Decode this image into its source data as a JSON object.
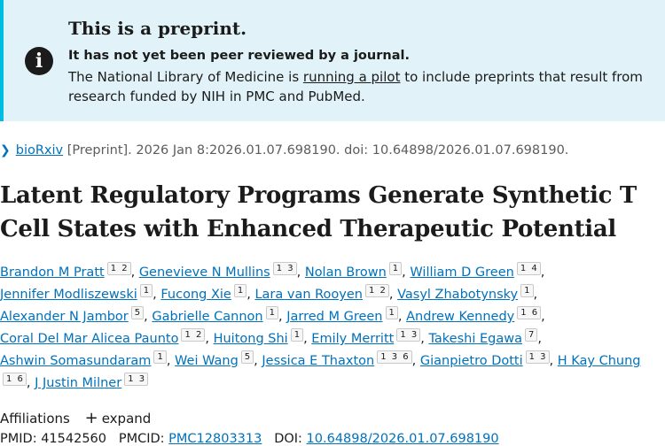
{
  "banner": {
    "title": "This is a preprint.",
    "strong": "It has not yet been peer reviewed by a journal.",
    "text_before": "The National Library of Medicine is ",
    "link": "running a pilot",
    "text_after": " to include preprints that result from research funded by NIH in PMC and PubMed."
  },
  "citation": {
    "journal": "bioRxiv",
    "rest": "[Preprint]. 2026 Jan 8:2026.01.07.698190. doi: 10.64898/2026.01.07.698190."
  },
  "title": "Latent Regulatory Programs Generate Synthetic T Cell States with Enhanced Therapeutic Potential",
  "authors": [
    {
      "name": "Brandon M Pratt",
      "aff": "1 2"
    },
    {
      "name": "Genevieve N Mullins",
      "aff": "1 3"
    },
    {
      "name": "Nolan Brown",
      "aff": "1"
    },
    {
      "name": "William D Green",
      "aff": "1 4"
    },
    {
      "name": "Jennifer Modliszewski",
      "aff": "1"
    },
    {
      "name": "Fucong Xie",
      "aff": "1"
    },
    {
      "name": "Lara van Rooyen",
      "aff": "1 2"
    },
    {
      "name": "Vasyl Zhabotynsky",
      "aff": "1"
    },
    {
      "name": "Alexander N Jambor",
      "aff": "5"
    },
    {
      "name": "Gabrielle Cannon",
      "aff": "1"
    },
    {
      "name": "Jarred M Green",
      "aff": "1"
    },
    {
      "name": "Andrew Kennedy",
      "aff": "1 6"
    },
    {
      "name": "Coral Del Mar Alicea Paunto",
      "aff": "1 2"
    },
    {
      "name": "Huitong Shi",
      "aff": "1"
    },
    {
      "name": "Emily Merritt",
      "aff": "1 3"
    },
    {
      "name": "Takeshi Egawa",
      "aff": "7"
    },
    {
      "name": "Ashwin Somasundaram",
      "aff": "1"
    },
    {
      "name": "Wei Wang",
      "aff": "5"
    },
    {
      "name": "Jessica E Thaxton",
      "aff": "1 3 6"
    },
    {
      "name": "Gianpietro Dotti",
      "aff": "1 3"
    },
    {
      "name": "H Kay Chung",
      "aff": "1 6"
    },
    {
      "name": "J Justin Milner",
      "aff": "1 3"
    }
  ],
  "affiliations": {
    "label": "Affiliations",
    "expand": "expand"
  },
  "ids": {
    "pmid_label": "PMID: ",
    "pmid": "41542560",
    "pmcid_label": "PMCID: ",
    "pmcid": "PMC12803313",
    "doi_label": "DOI: ",
    "doi": "10.64898/2026.01.07.698190"
  },
  "icons": {
    "info": "info-icon",
    "chevron": "chevron-right-icon",
    "plus": "plus-icon"
  },
  "colors": {
    "banner_bg": "#e1f3f8",
    "banner_border": "#00bde3",
    "link": "#0071bc"
  }
}
